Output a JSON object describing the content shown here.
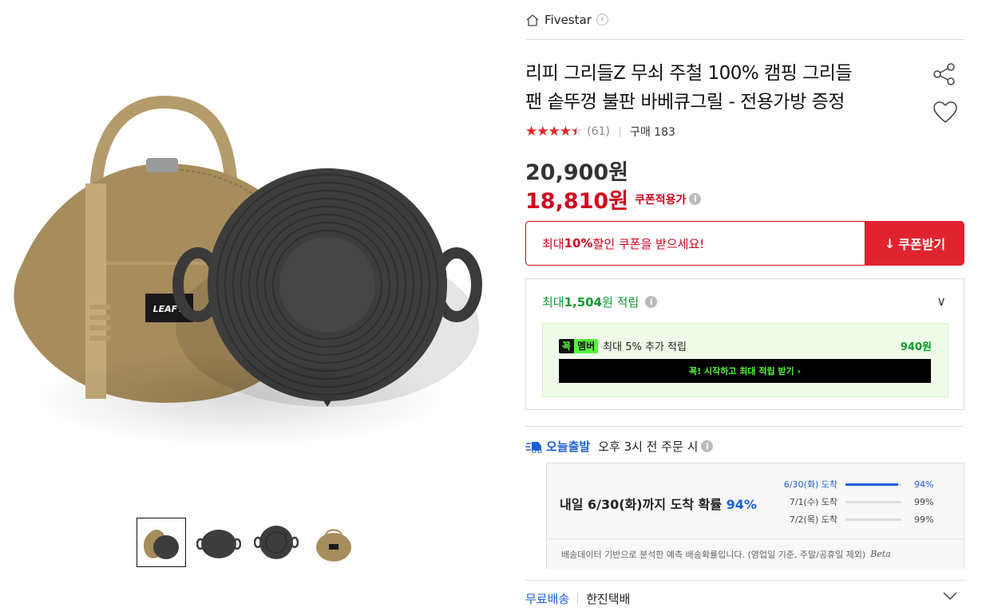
{
  "product_image": {
    "bag_label": "LEAFY."
  },
  "thumbnails": [
    {
      "name": "thumb-bag-and-pan"
    },
    {
      "name": "thumb-pan-side"
    },
    {
      "name": "thumb-pan-top"
    },
    {
      "name": "thumb-bag"
    }
  ],
  "header": {
    "brand": "Fivestar",
    "brand_icon": "home-icon",
    "arrow": "›"
  },
  "product": {
    "title_line1": "리피 그리들Z 무쇠 주철 100% 캠핑 그리들",
    "title_line2": "팬 솥뚜껑 불판 바베큐그릴 - 전용가방 증정",
    "rating_value": 4.5,
    "rating_stars": "★★★★★",
    "review_count": "(61)",
    "purchase_label": "구매 183",
    "share_icon": "share-icon",
    "wishlist_icon": "heart-icon"
  },
  "price": {
    "original": "20,900원",
    "coupon_price": "18,810원",
    "coupon_label": "쿠폰적용가",
    "info": "i"
  },
  "coupon": {
    "msg_prefix": "최대 ",
    "msg_highlight": "10%",
    "msg_suffix": " 할인 쿠폰을 받으세요!",
    "button_label": "쿠폰받기",
    "button_icon": "↓",
    "accent": "#e0242f"
  },
  "reward": {
    "prefix": "최대 ",
    "amount": "1,504",
    "suffix": "원 적립",
    "info": "i",
    "chevron": "∨",
    "member_badge_k": "꾝",
    "member_badge_m": "멤버",
    "member_text": "최대 5% 추가 적립",
    "member_points": "940원",
    "member_button": "꾝! 시작하고 최대 적립 받기 ›",
    "accent": "#0a9a2e"
  },
  "delivery": {
    "today_label": "오늘출발",
    "cutoff": "오후 3시 전 주문 시",
    "info": "i",
    "main_prefix": "내일 6/30(화)까지 도착 확률 ",
    "main_pct": "94%",
    "probabilities": [
      {
        "date": "6/30(화) 도착",
        "value": 94,
        "pct": "94%"
      },
      {
        "date": "7/1(수) 도착",
        "value": 99,
        "pct": "99%"
      },
      {
        "date": "7/2(목) 도착",
        "value": 99,
        "pct": "99%"
      }
    ],
    "note": "배송데이터 기반으로 분석한 예측 배송확률입니다. (영업일 기준, 주말/공휴일 제외)",
    "beta": "Beta",
    "accent": "#1c5fd6"
  },
  "shipping": {
    "free_label": "무료배송",
    "courier": "한진택배",
    "chevron": "∨"
  }
}
